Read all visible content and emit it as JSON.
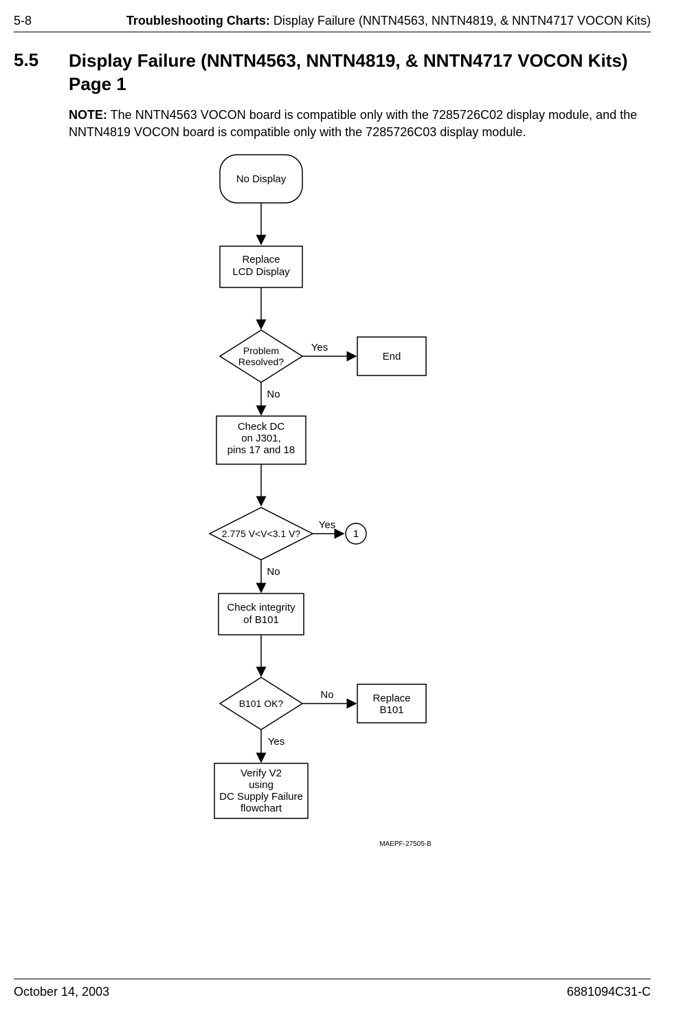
{
  "header": {
    "page_num": "5-8",
    "chapter_bold": "Troubleshooting Charts:",
    "chapter_rest": " Display Failure (NNTN4563, NNTN4819, & NNTN4717 VOCON Kits)"
  },
  "section": {
    "num": "5.5",
    "title_line1": "Display Failure (NNTN4563, NNTN4819, & NNTN4717 VOCON Kits)",
    "title_line2": "Page 1"
  },
  "note": {
    "label": "NOTE:",
    "text": " The NNTN4563 VOCON board is compatible only with the 7285726C02 display module, and the NNTN4819 VOCON board is compatible only with the 7285726C03 display module."
  },
  "chart_data": {
    "type": "flowchart",
    "nodes": {
      "start": "No Display",
      "step1": [
        "Replace",
        "LCD Display"
      ],
      "decision1": [
        "Problem",
        "Resolved?"
      ],
      "end1": "End",
      "step2": [
        "Check DC",
        "on J301,",
        "pins 17 and 18"
      ],
      "decision2": "2.775 V<V<3.1 V?",
      "connector2": "1",
      "step3": [
        "Check integrity",
        "of B101"
      ],
      "decision3": "B101 OK?",
      "end3": [
        "Replace",
        "B101"
      ],
      "step4": [
        "Verify V2",
        "using",
        "DC Supply Failure",
        "flowchart"
      ]
    },
    "edges": {
      "d1_yes": "Yes",
      "d1_no": "No",
      "d2_yes": "Yes",
      "d2_no": "No",
      "d3_no": "No",
      "d3_yes": "Yes"
    },
    "figure_code": "MAEPF-27505-B"
  },
  "footer": {
    "date": "October 14, 2003",
    "doc_num": "6881094C31-C"
  }
}
